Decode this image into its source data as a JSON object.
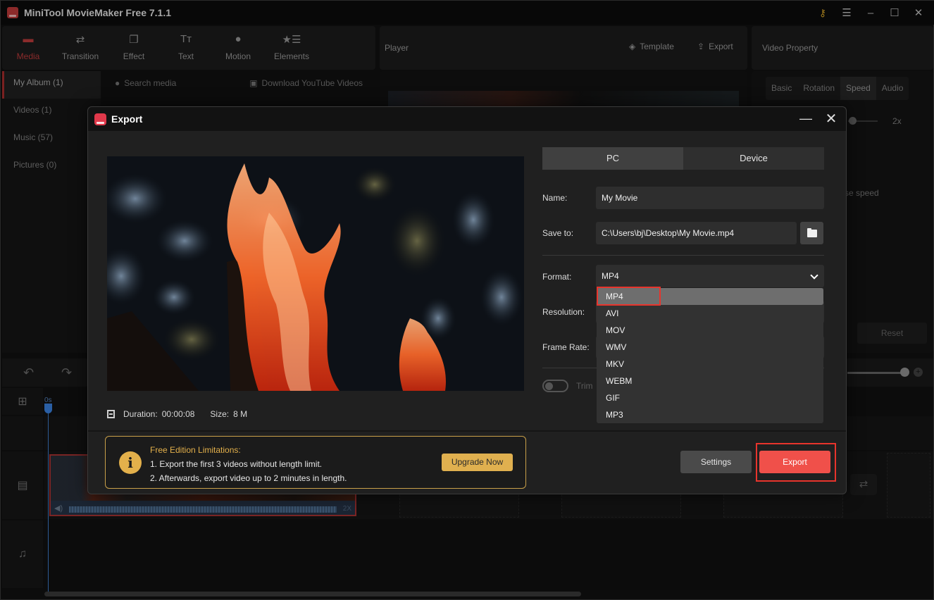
{
  "app": {
    "title": "MiniTool MovieMaker Free 7.1.1",
    "window_controls": [
      "key-icon",
      "menu-icon",
      "minimize-icon",
      "maximize-icon",
      "close-icon"
    ]
  },
  "toolbar": {
    "items": [
      {
        "label": "Media",
        "icon": "folder-icon",
        "active": true
      },
      {
        "label": "Transition",
        "icon": "transition-arrows-icon"
      },
      {
        "label": "Effect",
        "icon": "effect-icon"
      },
      {
        "label": "Text",
        "icon": "text-icon"
      },
      {
        "label": "Motion",
        "icon": "motion-icon"
      },
      {
        "label": "Elements",
        "icon": "elements-icon"
      }
    ]
  },
  "player": {
    "title": "Player",
    "template_label": "Template",
    "export_label": "Export"
  },
  "video_property": {
    "title": "Video Property",
    "tabs": [
      "Basic",
      "Rotation",
      "Speed",
      "Audio"
    ],
    "active_tab": "Speed",
    "speed_label": "2x",
    "reverse_label": "rse speed",
    "reset_label": "Reset"
  },
  "media": {
    "sidebar": [
      {
        "label": "My Album (1)",
        "active": true
      },
      {
        "label": "Videos (1)"
      },
      {
        "label": "Music (57)"
      },
      {
        "label": "Pictures (0)"
      }
    ],
    "search_placeholder": "Search media",
    "download_label": "Download YouTube Videos"
  },
  "timeline": {
    "ruler_start": "0s",
    "clip_speed": "2X"
  },
  "export_dialog": {
    "title": "Export",
    "targets": [
      "PC",
      "Device"
    ],
    "active_target": "PC",
    "name_label": "Name:",
    "name_value": "My Movie",
    "save_label": "Save to:",
    "save_value": "C:\\Users\\bj\\Desktop\\My Movie.mp4",
    "format_label": "Format:",
    "format_value": "MP4",
    "format_options": [
      "MP4",
      "AVI",
      "MOV",
      "WMV",
      "MKV",
      "WEBM",
      "GIF",
      "MP3"
    ],
    "resolution_label": "Resolution:",
    "framerate_label": "Frame Rate:",
    "trim_label": "Trim",
    "duration_label": "Duration:",
    "duration_value": "00:00:08",
    "size_label": "Size:",
    "size_value": "8 M",
    "limits": {
      "title": "Free Edition Limitations:",
      "line1": "1. Export the first 3 videos without length limit.",
      "line2": "2. Afterwards, export video up to 2 minutes in length.",
      "upgrade_label": "Upgrade Now"
    },
    "settings_label": "Settings",
    "export_label": "Export"
  },
  "colors": {
    "accent_red": "#f0504a",
    "highlight_red": "#e8342c",
    "limit_gold": "#e3b04b"
  }
}
